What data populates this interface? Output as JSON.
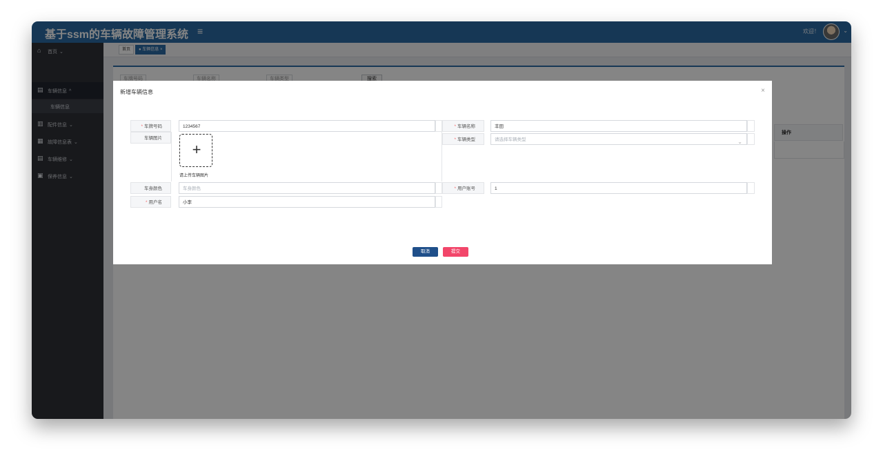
{
  "app": {
    "title": "基于ssm的车辆故障管理系统",
    "menu_toggle": "≡",
    "welcome": "欢迎！",
    "avatar_caret": "⌄"
  },
  "sidebar": {
    "items": [
      {
        "icon": "⌂",
        "label": "首页",
        "caret": "⌄"
      },
      {
        "icon": "▤",
        "label": "车辆信息",
        "caret": "^"
      },
      {
        "icon": "▥",
        "label": "配件信息",
        "caret": "⌄"
      },
      {
        "icon": "▦",
        "label": "故障信息表",
        "caret": "⌄"
      },
      {
        "icon": "▤",
        "label": "车辆维修",
        "caret": "⌄"
      },
      {
        "icon": "▣",
        "label": "保养信息",
        "caret": "⌄"
      }
    ],
    "sub_item": "车辆信息"
  },
  "tabs": {
    "home": "首页",
    "current": "● 车辆信息",
    "close": "×"
  },
  "search": {
    "plate_placeholder": "车牌号码",
    "name_placeholder": "车辆名称",
    "type_placeholder": "车辆类型",
    "button": "搜索"
  },
  "table": {
    "ops_header": "操作"
  },
  "dialog": {
    "title": "新增车辆信息",
    "close": "×",
    "fields": {
      "plate": {
        "label": "车牌号码",
        "value": "1234567",
        "required": "*"
      },
      "name": {
        "label": "车辆名称",
        "value": "丰田",
        "required": "*"
      },
      "image": {
        "label": "车辆图片",
        "hint": "请上传车辆图片",
        "plus": "+"
      },
      "type": {
        "label": "车辆类型",
        "placeholder": "请选择车辆类型",
        "required": "*",
        "caret": "⌄"
      },
      "color": {
        "label": "车身颜色",
        "placeholder": "车身颜色"
      },
      "account": {
        "label": "用户账号",
        "value": "1",
        "required": "*"
      },
      "username": {
        "label": "用户名",
        "value": "小李",
        "required": "*"
      }
    },
    "buttons": {
      "cancel": "取消",
      "submit": "提交"
    }
  },
  "colors": {
    "topbar": "#2b6aa3",
    "sidebar": "#2e3036",
    "cancel_button": "#1f4f8a",
    "submit_button": "#f2466a",
    "required": "#f56c6c"
  }
}
